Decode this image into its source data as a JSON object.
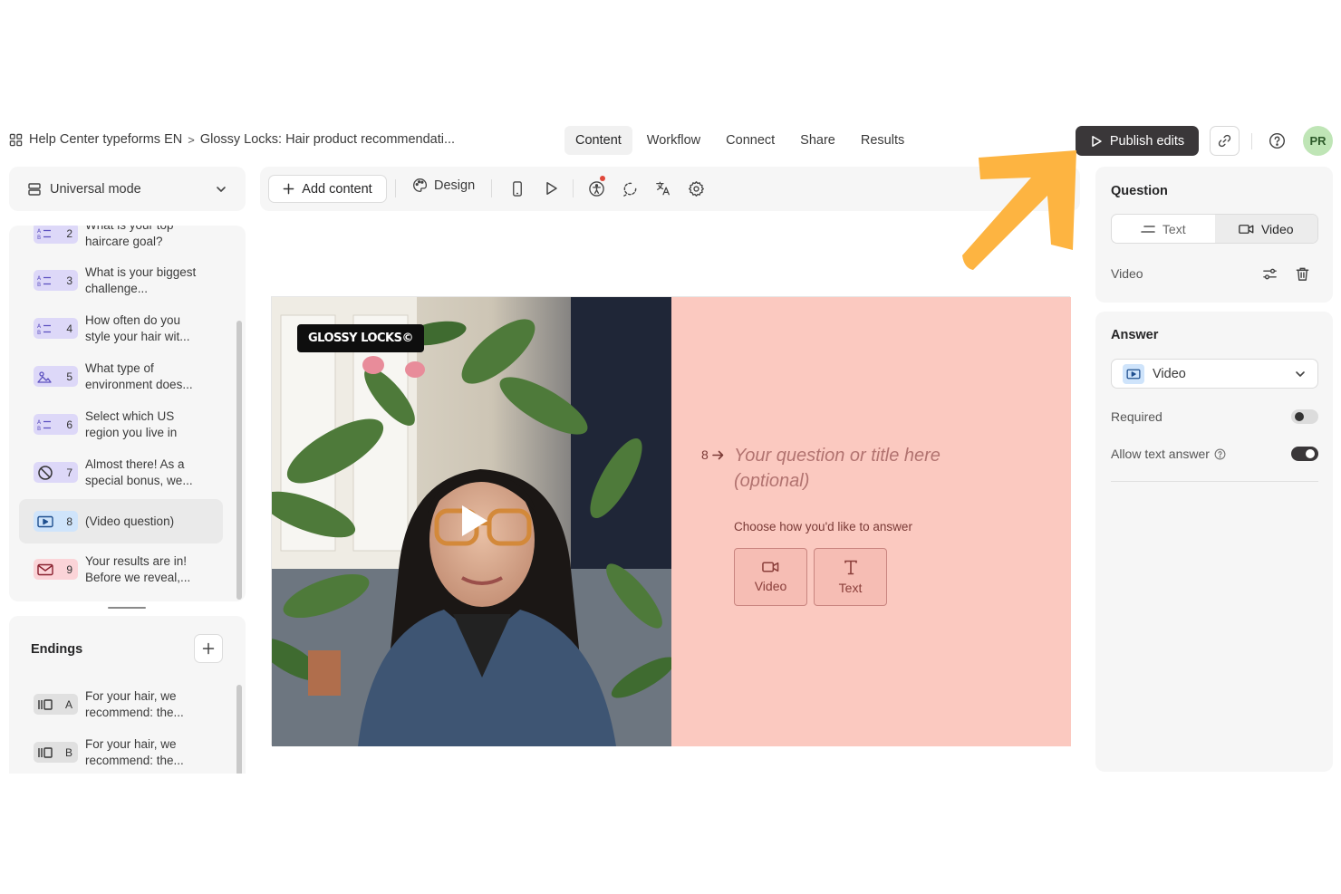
{
  "breadcrumb": {
    "workspace": "Help Center typeforms EN",
    "separator": ">",
    "form": "Glossy Locks: Hair product recommendati..."
  },
  "nav": {
    "tabs": [
      "Content",
      "Workflow",
      "Connect",
      "Share",
      "Results"
    ],
    "active": "Content"
  },
  "header": {
    "publish_label": "Publish edits",
    "avatar_initials": "PR"
  },
  "annotation": {
    "arrow_color": "#FDB441"
  },
  "sidebar": {
    "mode_label": "Universal mode",
    "questions": [
      {
        "num": "2",
        "text": "What is your top haircare goal?",
        "icon": "multiple-choice-icon",
        "color": "purple"
      },
      {
        "num": "3",
        "text": "What is your biggest challenge...",
        "icon": "multiple-choice-icon",
        "color": "purple"
      },
      {
        "num": "4",
        "text": "How often do you style your hair wit...",
        "icon": "multiple-choice-icon",
        "color": "purple"
      },
      {
        "num": "5",
        "text": "What type of environment does...",
        "icon": "picture-choice-icon",
        "color": "purple"
      },
      {
        "num": "6",
        "text": "Select which US region you live in",
        "icon": "multiple-choice-icon",
        "color": "purple"
      },
      {
        "num": "7",
        "text": "Almost there! As a special bonus, we...",
        "icon": "no-entry-icon",
        "color": "purple"
      },
      {
        "num": "8",
        "text": "(Video question)",
        "icon": "video-question-icon",
        "color": "blue",
        "selected": true
      },
      {
        "num": "9",
        "text": "Your results are in! Before we reveal,...",
        "icon": "email-icon",
        "color": "red"
      }
    ],
    "endings_title": "Endings",
    "endings": [
      {
        "letter": "A",
        "text": "For your hair, we recommend: the..."
      },
      {
        "letter": "B",
        "text": "For your hair, we recommend: the..."
      }
    ]
  },
  "toolbar": {
    "add_content_label": "Add content",
    "design_label": "Design"
  },
  "canvas": {
    "brand_label": "GLOSSY LOCKS©",
    "question_number": "8",
    "question_placeholder": "Your question or title here (optional)",
    "choose_prompt": "Choose how you'd like to answer",
    "choices": [
      "Video",
      "Text"
    ],
    "background_color": "#FBC9C0"
  },
  "panel": {
    "question_title": "Question",
    "segments": [
      "Text",
      "Video"
    ],
    "active_segment": "Video",
    "video_label": "Video",
    "answer_title": "Answer",
    "answer_type": "Video",
    "required_label": "Required",
    "required": false,
    "allow_text_label": "Allow text answer",
    "allow_text": true
  }
}
